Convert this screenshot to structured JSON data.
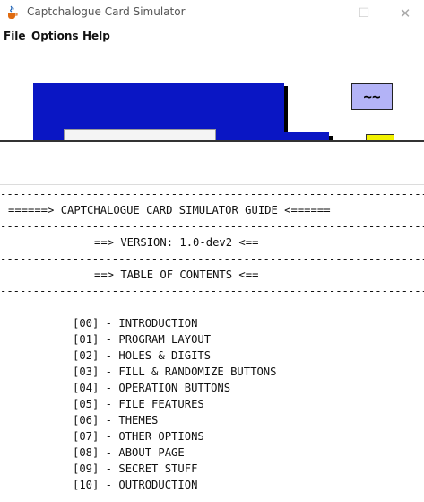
{
  "window": {
    "title": "Captchalogue Card Simulator",
    "minimize_glyph": "—",
    "maximize_glyph": "☐",
    "close_glyph": "✕"
  },
  "menu": {
    "items": [
      {
        "label": "File"
      },
      {
        "label": "Options"
      },
      {
        "label": "Help"
      }
    ]
  },
  "card_area": {
    "tilde_button_label": "~~",
    "colors": {
      "card": "#0a16c4",
      "tilde": "#b3b3f7",
      "yellow": "#f2f200"
    }
  },
  "guide": {
    "separator": "--------------------------------------------------------------------",
    "header": "======> CAPTCHALOGUE CARD SIMULATOR GUIDE <======",
    "version": "==> VERSION: 1.0-dev2 <==",
    "toc_title": "==> TABLE OF CONTENTS <==",
    "toc": [
      "[00] - INTRODUCTION",
      "[01] - PROGRAM LAYOUT",
      "[02] - HOLES & DIGITS",
      "[03] - FILL & RANDOMIZE BUTTONS",
      "[04] - OPERATION BUTTONS",
      "[05] - FILE FEATURES",
      "[06] - THEMES",
      "[07] - OTHER OPTIONS",
      "[08] - ABOUT PAGE",
      "[09] - SECRET STUFF",
      "[10] - OUTRODUCTION"
    ]
  }
}
